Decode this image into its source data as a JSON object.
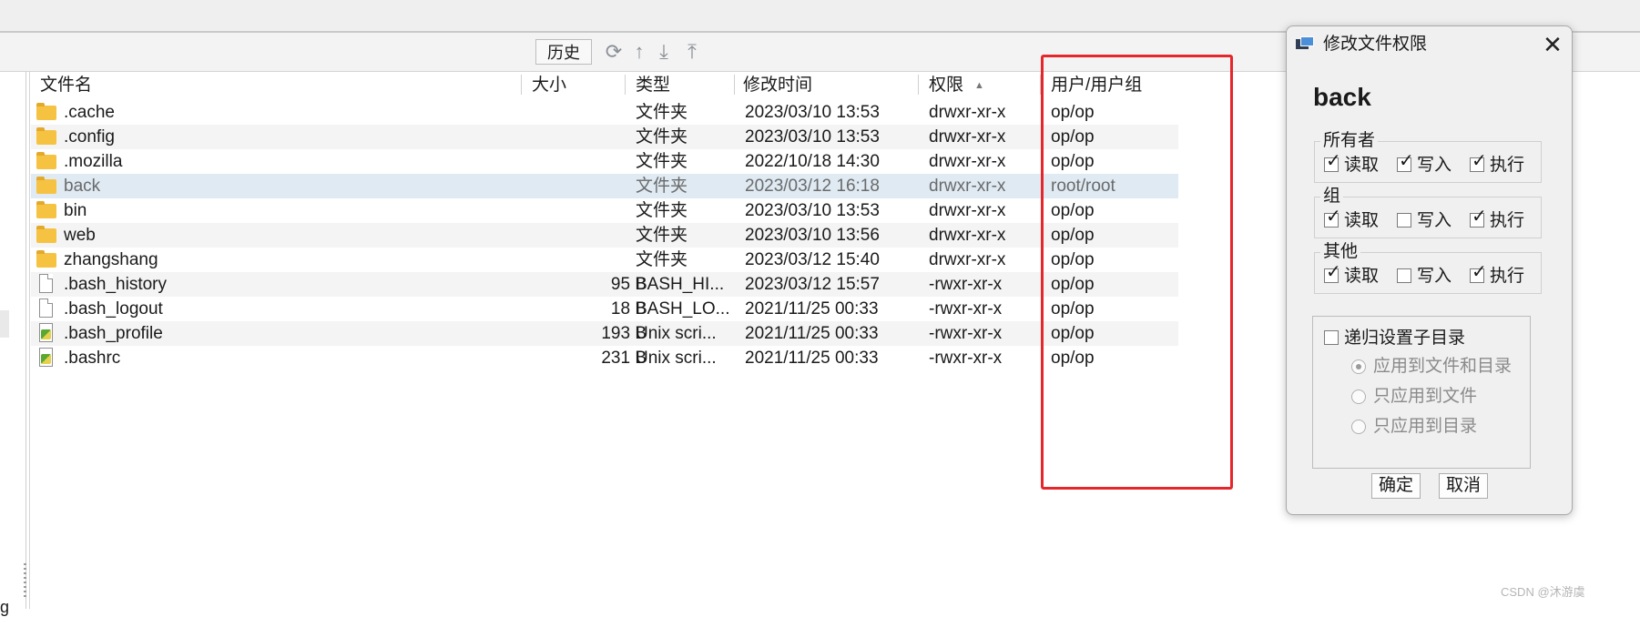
{
  "toolbar": {
    "history_label": "历史",
    "icons": [
      "refresh-icon",
      "upload-arrow-icon",
      "download-icon",
      "upload-icon"
    ]
  },
  "left_pane": {
    "fragment_text": "g"
  },
  "table": {
    "columns": [
      "文件名",
      "大小",
      "类型",
      "修改时间",
      "权限",
      "用户/用户组"
    ],
    "sort_column": "权限",
    "sort_direction": "ascending",
    "rows": [
      {
        "icon": "folder-icon",
        "name": ".cache",
        "size": "",
        "type": "文件夹",
        "modified": "2023/03/10 13:53",
        "perms": "drwxr-xr-x",
        "owner": "op/op"
      },
      {
        "icon": "folder-icon",
        "name": ".config",
        "size": "",
        "type": "文件夹",
        "modified": "2023/03/10 13:53",
        "perms": "drwxr-xr-x",
        "owner": "op/op"
      },
      {
        "icon": "folder-icon",
        "name": ".mozilla",
        "size": "",
        "type": "文件夹",
        "modified": "2022/10/18 14:30",
        "perms": "drwxr-xr-x",
        "owner": "op/op"
      },
      {
        "icon": "folder-icon",
        "name": "back",
        "size": "",
        "type": "文件夹",
        "modified": "2023/03/12 16:18",
        "perms": "drwxr-xr-x",
        "owner": "root/root",
        "selected": true
      },
      {
        "icon": "folder-icon",
        "name": "bin",
        "size": "",
        "type": "文件夹",
        "modified": "2023/03/10 13:53",
        "perms": "drwxr-xr-x",
        "owner": "op/op"
      },
      {
        "icon": "folder-icon",
        "name": "web",
        "size": "",
        "type": "文件夹",
        "modified": "2023/03/10 13:56",
        "perms": "drwxr-xr-x",
        "owner": "op/op"
      },
      {
        "icon": "folder-icon",
        "name": "zhangshang",
        "size": "",
        "type": "文件夹",
        "modified": "2023/03/12 15:40",
        "perms": "drwxr-xr-x",
        "owner": "op/op"
      },
      {
        "icon": "file-icon",
        "name": ".bash_history",
        "size": "95 B",
        "type": "BASH_HI...",
        "modified": "2023/03/12 15:57",
        "perms": "-rwxr-xr-x",
        "owner": "op/op"
      },
      {
        "icon": "file-icon",
        "name": ".bash_logout",
        "size": "18 B",
        "type": "BASH_LO...",
        "modified": "2021/11/25 00:33",
        "perms": "-rwxr-xr-x",
        "owner": "op/op"
      },
      {
        "icon": "script-icon",
        "name": ".bash_profile",
        "size": "193 B",
        "type": "Unix scri...",
        "modified": "2021/11/25 00:33",
        "perms": "-rwxr-xr-x",
        "owner": "op/op"
      },
      {
        "icon": "script-icon",
        "name": ".bashrc",
        "size": "231 B",
        "type": "Unix scri...",
        "modified": "2021/11/25 00:33",
        "perms": "-rwxr-xr-x",
        "owner": "op/op"
      }
    ]
  },
  "highlight_color": "#e5262a",
  "dialog": {
    "title": "修改文件权限",
    "filename": "back",
    "groups": [
      {
        "label": "所有者",
        "perms": [
          {
            "label": "读取",
            "checked": true
          },
          {
            "label": "写入",
            "checked": true
          },
          {
            "label": "执行",
            "checked": true
          }
        ]
      },
      {
        "label": "组",
        "perms": [
          {
            "label": "读取",
            "checked": true
          },
          {
            "label": "写入",
            "checked": false
          },
          {
            "label": "执行",
            "checked": true
          }
        ]
      },
      {
        "label": "其他",
        "perms": [
          {
            "label": "读取",
            "checked": true
          },
          {
            "label": "写入",
            "checked": false
          },
          {
            "label": "执行",
            "checked": true
          }
        ]
      }
    ],
    "recursive": {
      "label": "递归设置子目录",
      "checked": false,
      "options": [
        {
          "label": "应用到文件和目录",
          "selected": true
        },
        {
          "label": "只应用到文件",
          "selected": false
        },
        {
          "label": "只应用到目录",
          "selected": false
        }
      ]
    },
    "ok_label": "确定",
    "cancel_label": "取消"
  },
  "watermark": "CSDN @沐游虞"
}
